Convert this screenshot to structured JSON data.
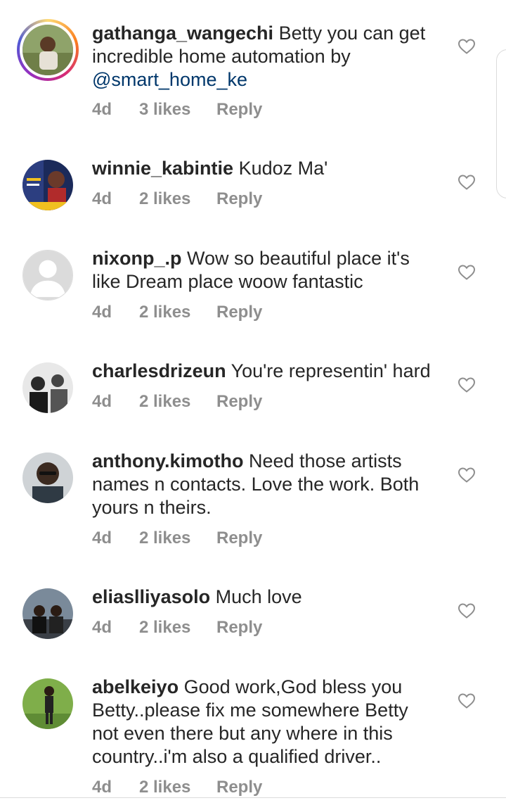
{
  "comments": [
    {
      "username": "gathanga_wangechi",
      "text": " Betty you can get incredible home automation by ",
      "mention": "@smart_home_ke",
      "time": "4d",
      "likes": "3 likes",
      "reply": "Reply"
    },
    {
      "username": "winnie_kabintie",
      "text": " Kudoz Ma'",
      "time": "4d",
      "likes": "2 likes",
      "reply": "Reply"
    },
    {
      "username": "nixonp_.p",
      "text": " Wow so beautiful place it's like Dream place woow fantastic",
      "time": "4d",
      "likes": "2 likes",
      "reply": "Reply"
    },
    {
      "username": "charlesdrizeun",
      "text": " You're representin' hard",
      "time": "4d",
      "likes": "2 likes",
      "reply": "Reply"
    },
    {
      "username": "anthony.kimotho",
      "text": " Need those artists names n contacts. Love the work. Both yours n theirs.",
      "time": "4d",
      "likes": "2 likes",
      "reply": "Reply"
    },
    {
      "username": "eliaslliyasolo",
      "text": " Much love",
      "time": "4d",
      "likes": "2 likes",
      "reply": "Reply"
    },
    {
      "username": "abelkeiyo",
      "text": " Good work,God bless you Betty..please fix me somewhere Betty not even there but any where in this country..i'm also a qualified driver..",
      "time": "4d",
      "likes": "2 likes",
      "reply": "Reply"
    }
  ],
  "colors": {
    "text": "#262626",
    "meta": "#8e8e8e",
    "mention": "#00376b"
  },
  "icons": {
    "like": "heart-outline-icon"
  }
}
